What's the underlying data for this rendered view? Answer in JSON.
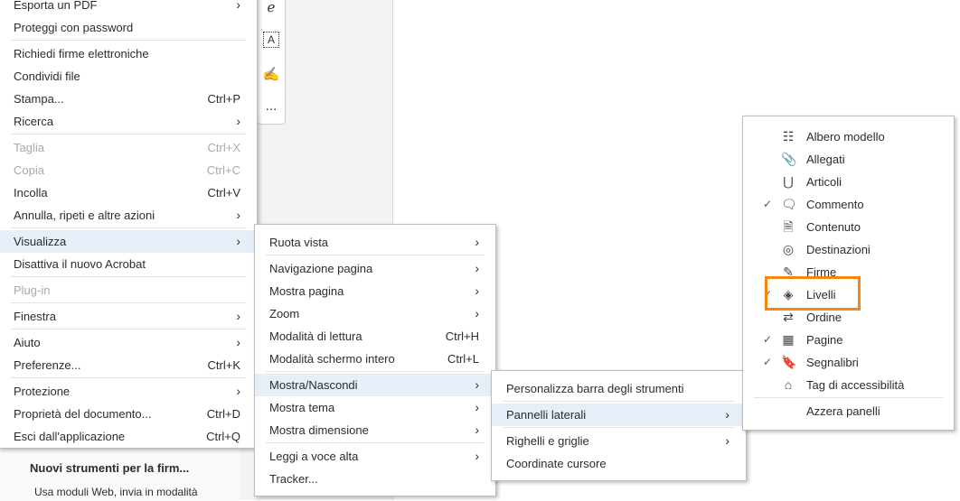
{
  "background": {
    "panel_title": "Nuovi strumenti per la firm...",
    "panel_subtitle": "Usa moduli Web, invia in modalità",
    "toolbar_more": "..."
  },
  "main_menu": [
    {
      "label": "Esporta un PDF",
      "arrow": true
    },
    {
      "label": "Proteggi con password"
    },
    {
      "sep": true
    },
    {
      "label": "Richiedi firme elettroniche"
    },
    {
      "label": "Condividi file"
    },
    {
      "label": "Stampa...",
      "shortcut": "Ctrl+P"
    },
    {
      "label": "Ricerca",
      "arrow": true
    },
    {
      "sep": true
    },
    {
      "label": "Taglia",
      "shortcut": "Ctrl+X",
      "disabled": true
    },
    {
      "label": "Copia",
      "shortcut": "Ctrl+C",
      "disabled": true
    },
    {
      "label": "Incolla",
      "shortcut": "Ctrl+V"
    },
    {
      "label": "Annulla, ripeti e altre azioni",
      "arrow": true
    },
    {
      "sep": true
    },
    {
      "label": "Visualizza",
      "arrow": true,
      "highlighted": true
    },
    {
      "label": "Disattiva il nuovo Acrobat"
    },
    {
      "sep": true
    },
    {
      "label": "Plug-in",
      "disabled": true
    },
    {
      "sep": true
    },
    {
      "label": "Finestra",
      "arrow": true
    },
    {
      "sep": true
    },
    {
      "label": "Aiuto",
      "arrow": true
    },
    {
      "label": "Preferenze...",
      "shortcut": "Ctrl+K"
    },
    {
      "sep": true
    },
    {
      "label": "Protezione",
      "arrow": true
    },
    {
      "label": "Proprietà del documento...",
      "shortcut": "Ctrl+D"
    },
    {
      "label": "Esci dall'applicazione",
      "shortcut": "Ctrl+Q"
    }
  ],
  "view_menu": [
    {
      "label": "Ruota vista",
      "arrow": true
    },
    {
      "sep": true
    },
    {
      "label": "Navigazione pagina",
      "arrow": true
    },
    {
      "label": "Mostra pagina",
      "arrow": true
    },
    {
      "label": "Zoom",
      "arrow": true
    },
    {
      "label": "Modalità di lettura",
      "shortcut": "Ctrl+H"
    },
    {
      "label": "Modalità schermo intero",
      "shortcut": "Ctrl+L"
    },
    {
      "sep": true
    },
    {
      "label": "Mostra/Nascondi",
      "arrow": true,
      "highlighted": true
    },
    {
      "label": "Mostra tema",
      "arrow": true
    },
    {
      "label": "Mostra dimensione",
      "arrow": true
    },
    {
      "sep": true
    },
    {
      "label": "Leggi a voce alta",
      "arrow": true
    },
    {
      "label": "Tracker..."
    }
  ],
  "showhide_menu": [
    {
      "label": "Personalizza barra degli strumenti"
    },
    {
      "sep": true
    },
    {
      "label": "Pannelli laterali",
      "arrow": true,
      "highlighted": true
    },
    {
      "sep": true
    },
    {
      "label": "Righelli e griglie",
      "arrow": true
    },
    {
      "label": "Coordinate cursore"
    }
  ],
  "panels_menu": [
    {
      "label": "Albero modello",
      "icon": "tree-icon",
      "glyph": "☷"
    },
    {
      "label": "Allegati",
      "icon": "paperclip-icon",
      "glyph": "📎"
    },
    {
      "label": "Articoli",
      "icon": "articles-icon",
      "glyph": "⋃"
    },
    {
      "label": "Commento",
      "icon": "comment-icon",
      "glyph": "🗨",
      "checked": true
    },
    {
      "label": "Contenuto",
      "icon": "content-icon",
      "glyph": "🗎"
    },
    {
      "label": "Destinazioni",
      "icon": "target-icon",
      "glyph": "◎"
    },
    {
      "label": "Firme",
      "icon": "pen-icon",
      "glyph": "✎"
    },
    {
      "label": "Livelli",
      "icon": "layers-icon",
      "glyph": "◈",
      "checked": true
    },
    {
      "label": "Ordine",
      "icon": "order-icon",
      "glyph": "⇄"
    },
    {
      "label": "Pagine",
      "icon": "pages-grid-icon",
      "glyph": "▦",
      "checked": true
    },
    {
      "label": "Segnalibri",
      "icon": "bookmark-icon",
      "glyph": "🔖",
      "checked": true
    },
    {
      "label": "Tag di accessibilità",
      "icon": "tag-icon",
      "glyph": "⌂"
    },
    {
      "sep": true
    },
    {
      "label": "Azzera panelli"
    }
  ],
  "symbols": {
    "check": "✓",
    "arrow": "›"
  },
  "colors": {
    "highlight": "#e6eef8",
    "callout": "#f7860f"
  }
}
